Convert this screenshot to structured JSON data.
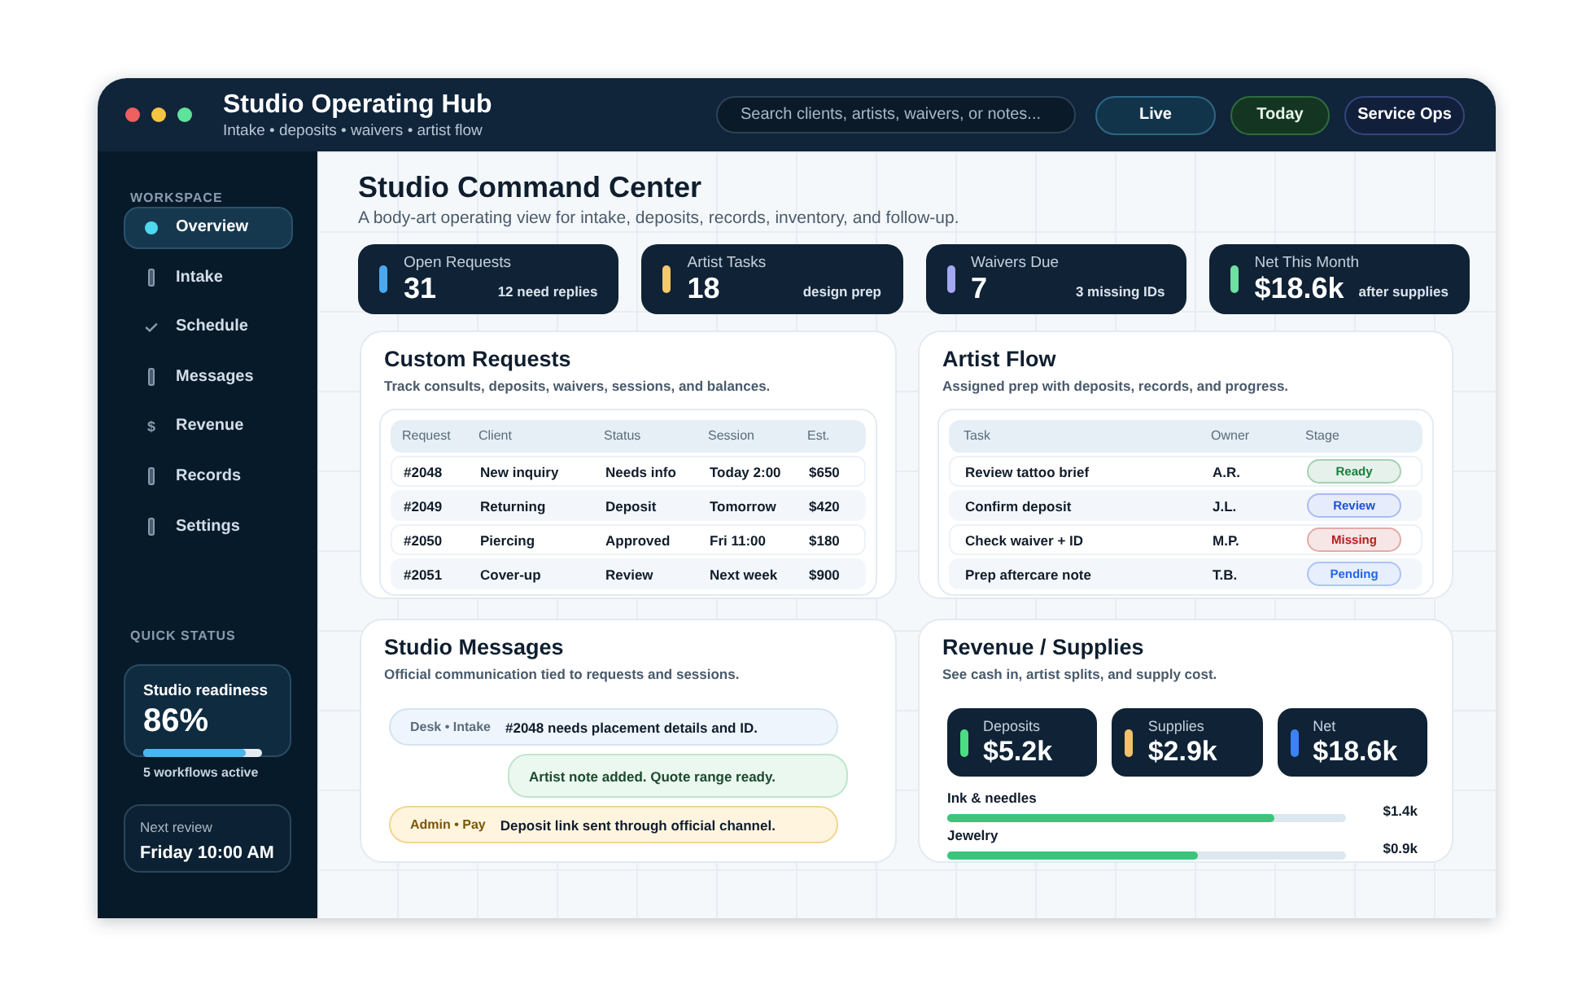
{
  "app": {
    "title": "Studio Operating Hub",
    "subtitle": "Intake • deposits • waivers • artist flow"
  },
  "search": {
    "placeholder": "Search clients, artists, waivers, or notes..."
  },
  "header_buttons": [
    {
      "label": "Live",
      "kind": "live"
    },
    {
      "label": "Today",
      "kind": "today"
    },
    {
      "label": "Service Ops",
      "kind": "ops"
    }
  ],
  "sidebar": {
    "section": "WORKSPACE",
    "items": [
      {
        "label": "Overview",
        "selected": true,
        "kind": "dot"
      },
      {
        "label": "Intake",
        "selected": false,
        "kind": "bar"
      },
      {
        "label": "Schedule",
        "selected": false,
        "kind": "check"
      },
      {
        "label": "Messages",
        "selected": false,
        "kind": "bar"
      },
      {
        "label": "Revenue",
        "selected": false,
        "kind": "glyph",
        "glyph": "$"
      },
      {
        "label": "Records",
        "selected": false,
        "kind": "bar"
      },
      {
        "label": "Settings",
        "selected": false,
        "kind": "bar"
      }
    ],
    "quick_status": {
      "label": "QUICK STATUS",
      "readiness": {
        "title": "Studio readiness",
        "value": "86%",
        "level": 0.86,
        "note": "5 workflows active"
      },
      "next_review": {
        "label": "Next review",
        "value": "Friday 10:00 AM"
      }
    }
  },
  "page": {
    "title": "Studio Command Center",
    "subtitle": "A body-art operating view for intake, deposits, records, inventory, and follow-up."
  },
  "stats": [
    {
      "label": "Open Requests",
      "value": "31",
      "note": "12 need replies",
      "color": "#4aa8f0"
    },
    {
      "label": "Artist Tasks",
      "value": "18",
      "note": "design prep",
      "color": "#f5c86a"
    },
    {
      "label": "Waivers Due",
      "value": "7",
      "note": "3 missing IDs",
      "color": "#a3a8f0"
    },
    {
      "label": "Net This Month",
      "value": "$18.6k",
      "note": "after supplies",
      "color": "#6ee0a0"
    }
  ],
  "custom_requests": {
    "title": "Custom Requests",
    "subtitle": "Track consults, deposits, waivers, sessions, and balances.",
    "columns": [
      "Request",
      "Client",
      "Status",
      "Session",
      "Est."
    ],
    "rows": [
      [
        "#2048",
        "New inquiry",
        "Needs info",
        "Today 2:00",
        "$650"
      ],
      [
        "#2049",
        "Returning",
        "Deposit",
        "Tomorrow",
        "$420"
      ],
      [
        "#2050",
        "Piercing",
        "Approved",
        "Fri 11:00",
        "$180"
      ],
      [
        "#2051",
        "Cover-up",
        "Review",
        "Next week",
        "$900"
      ]
    ]
  },
  "artist_flow": {
    "title": "Artist Flow",
    "subtitle": "Assigned prep with deposits, records, and progress.",
    "columns": [
      "Task",
      "Owner",
      "Stage"
    ],
    "rows": [
      {
        "task": "Review tattoo brief",
        "owner": "A.R.",
        "stage": "Ready",
        "color": "#15803d"
      },
      {
        "task": "Confirm deposit",
        "owner": "J.L.",
        "stage": "Review",
        "color": "#1d4ed8"
      },
      {
        "task": "Check waiver + ID",
        "owner": "M.P.",
        "stage": "Missing",
        "color": "#b91c1c"
      },
      {
        "task": "Prep aftercare note",
        "owner": "T.B.",
        "stage": "Pending",
        "color": "#2563eb"
      }
    ]
  },
  "messages": {
    "title": "Studio Messages",
    "subtitle": "Official communication tied to requests and sessions.",
    "items": [
      {
        "kind": "desk",
        "sender": "Desk • Intake",
        "text": "#2048 needs placement details and ID."
      },
      {
        "kind": "artist",
        "text": "Artist note added. Quote range ready."
      },
      {
        "kind": "admin",
        "sender": "Admin • Pay",
        "text": "Deposit link sent through official channel."
      }
    ]
  },
  "revenue": {
    "title": "Revenue / Supplies",
    "subtitle": "See cash in, artist splits, and supply cost.",
    "cards": [
      {
        "label": "Deposits",
        "value": "$5.2k",
        "color": "#4ade80"
      },
      {
        "label": "Supplies",
        "value": "$2.9k",
        "color": "#f5c06a"
      },
      {
        "label": "Net",
        "value": "$18.6k",
        "color": "#3b82f6"
      }
    ],
    "bars": [
      {
        "label": "Ink & needles",
        "value": "$1.4k",
        "level": 0.82
      },
      {
        "label": "Jewelry",
        "value": "$0.9k",
        "level": 0.63
      }
    ]
  }
}
